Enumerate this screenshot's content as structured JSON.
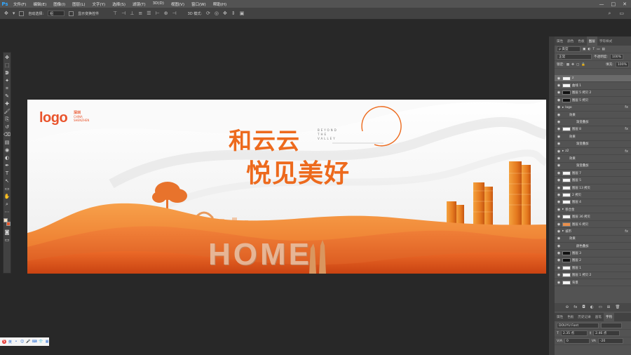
{
  "app": {
    "logo": "Ps"
  },
  "menu": [
    "文件(F)",
    "编辑(E)",
    "图像(I)",
    "图层(L)",
    "文字(Y)",
    "选择(S)",
    "滤镜(T)",
    "3D(D)",
    "视图(V)",
    "窗口(W)",
    "帮助(H)"
  ],
  "window_controls": [
    "—",
    "□",
    "✕"
  ],
  "options": {
    "auto_select_label": "自动选择:",
    "auto_select_value": "组",
    "show_transform_label": "显示变换控件",
    "mode_3d_label": "3D 模式:"
  },
  "tools": [
    "move-tool",
    "marquee-tool",
    "lasso-tool",
    "magic-wand-tool",
    "crop-tool",
    "eyedropper-tool",
    "healing-tool",
    "brush-tool",
    "stamp-tool",
    "history-brush-tool",
    "eraser-tool",
    "gradient-tool",
    "blur-tool",
    "dodge-tool",
    "pen-tool",
    "type-tool",
    "path-select-tool",
    "shape-tool",
    "hand-tool",
    "zoom-tool",
    "more-tool"
  ],
  "canvas": {
    "logo": "logo",
    "logo_sub_big": "深圳",
    "logo_sub_1": "CHINA",
    "logo_sub_2": "SHENZHEN",
    "headline_1": "和云云",
    "headline_2": "悦见美好",
    "tagline": [
      "BEYOND",
      "THE",
      "VALLEY"
    ],
    "home_word": "HOME"
  },
  "panel": {
    "tabs": [
      "属性",
      "颜色",
      "色板",
      "图层",
      "字符样式"
    ],
    "active_tab": "图层",
    "filter_label": "ρ 类型",
    "blend_mode": "正常",
    "opacity_label": "不透明度:",
    "opacity_value": "100%",
    "lock_label": "锁定:",
    "fill_label": "填充:",
    "fill_value": "100%"
  },
  "layers": [
    {
      "name": "z",
      "thumb": "white",
      "indent": 0,
      "fx": false,
      "selected": true
    },
    {
      "name": "曲线 1",
      "thumb": "white",
      "indent": 0,
      "fx": false,
      "selected": false
    },
    {
      "name": "图层 5 拷贝 2",
      "thumb": "black",
      "indent": 0,
      "fx": false,
      "selected": false
    },
    {
      "name": "图层 5 拷贝",
      "thumb": "black",
      "indent": 0,
      "fx": false,
      "selected": false
    },
    {
      "name": "logo",
      "thumb": "none",
      "indent": 0,
      "fx": true,
      "selected": false
    },
    {
      "name": "效果",
      "thumb": "none",
      "indent": 1,
      "fx": false,
      "selected": false
    },
    {
      "name": "渐变叠加",
      "thumb": "none",
      "indent": 2,
      "fx": false,
      "selected": false
    },
    {
      "name": "图层 8",
      "thumb": "white",
      "indent": 0,
      "fx": true,
      "selected": false
    },
    {
      "name": "效果",
      "thumb": "none",
      "indent": 1,
      "fx": false,
      "selected": false
    },
    {
      "name": "渐变叠加",
      "thumb": "none",
      "indent": 2,
      "fx": false,
      "selected": false
    },
    {
      "name": "z2",
      "thumb": "none",
      "indent": 0,
      "fx": true,
      "selected": false
    },
    {
      "name": "效果",
      "thumb": "none",
      "indent": 1,
      "fx": false,
      "selected": false
    },
    {
      "name": "渐变叠加",
      "thumb": "none",
      "indent": 2,
      "fx": false,
      "selected": false
    },
    {
      "name": "图层 7",
      "thumb": "white",
      "indent": 0,
      "fx": false,
      "selected": false
    },
    {
      "name": "图层 5",
      "thumb": "white",
      "indent": 0,
      "fx": false,
      "selected": false
    },
    {
      "name": "图层 13 拷贝",
      "thumb": "white",
      "indent": 0,
      "fx": false,
      "selected": false
    },
    {
      "name": "2 拷贝",
      "thumb": "white",
      "indent": 0,
      "fx": false,
      "selected": false
    },
    {
      "name": "图层 4",
      "thumb": "white",
      "indent": 0,
      "fx": false,
      "selected": false
    },
    {
      "name": "移合金",
      "thumb": "none",
      "indent": 0,
      "fx": false,
      "selected": false
    },
    {
      "name": "图层 36 拷贝",
      "thumb": "white",
      "indent": 0,
      "fx": false,
      "selected": false
    },
    {
      "name": "图层 6 拷贝",
      "thumb": "orange",
      "indent": 0,
      "fx": false,
      "selected": false
    },
    {
      "name": "城市",
      "thumb": "none",
      "indent": 0,
      "fx": true,
      "selected": false
    },
    {
      "name": "效果",
      "thumb": "none",
      "indent": 1,
      "fx": false,
      "selected": false
    },
    {
      "name": "颜色叠加",
      "thumb": "none",
      "indent": 2,
      "fx": false,
      "selected": false
    },
    {
      "name": "图层 3",
      "thumb": "black",
      "indent": 0,
      "fx": false,
      "selected": false
    },
    {
      "name": "图层 2",
      "thumb": "black",
      "indent": 0,
      "fx": false,
      "selected": false
    },
    {
      "name": "图层 1",
      "thumb": "white",
      "indent": 0,
      "fx": false,
      "selected": false
    },
    {
      "name": "图层 1 拷贝 2",
      "thumb": "white",
      "indent": 0,
      "fx": false,
      "selected": false
    },
    {
      "name": "背景",
      "thumb": "white",
      "indent": 0,
      "fx": false,
      "selected": false
    }
  ],
  "layer_footer": [
    "⊖",
    "fx",
    "◘",
    "◐",
    "▭",
    "⊞",
    "🗑"
  ],
  "char_tabs": [
    "属性",
    "色板",
    "历史记录",
    "画笔",
    "字符"
  ],
  "char": {
    "font": "DOUYU Font",
    "size": "2.35 点",
    "leading": "2.46 点",
    "kerning": "0",
    "tracking": "-20"
  }
}
